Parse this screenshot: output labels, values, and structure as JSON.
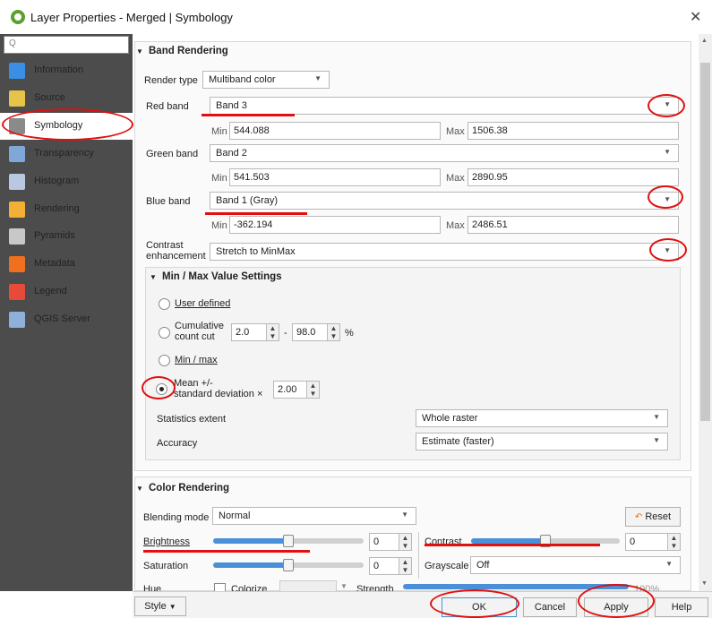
{
  "window": {
    "title": "Layer Properties - Merged | Symbology",
    "close": "✕",
    "search_placeholder": "Q"
  },
  "sidebar": {
    "items": [
      {
        "label": "Information",
        "icon": "information-icon",
        "color": "#3a8ee6"
      },
      {
        "label": "Source",
        "icon": "source-icon",
        "color": "#e8c34a"
      },
      {
        "label": "Symbology",
        "icon": "symbology-icon",
        "color": "#8a8a8a"
      },
      {
        "label": "Transparency",
        "icon": "transparency-icon",
        "color": "#7fa8d8"
      },
      {
        "label": "Histogram",
        "icon": "histogram-icon",
        "color": "#b8c8e0"
      },
      {
        "label": "Rendering",
        "icon": "rendering-icon",
        "color": "#f2b134"
      },
      {
        "label": "Pyramids",
        "icon": "pyramids-icon",
        "color": "#c8c8c8"
      },
      {
        "label": "Metadata",
        "icon": "metadata-icon",
        "color": "#f07020"
      },
      {
        "label": "Legend",
        "icon": "legend-icon",
        "color": "#e84a3a"
      },
      {
        "label": "QGIS Server",
        "icon": "qgis-server-icon",
        "color": "#8fb0d8"
      }
    ],
    "active_index": 2
  },
  "band_rendering": {
    "header": "Band Rendering",
    "render_type_label": "Render type",
    "render_type_value": "Multiband color",
    "red_band_label": "Red band",
    "red_band_value": "Band 3",
    "red_min": "544.088",
    "red_max": "1506.38",
    "green_band_label": "Green band",
    "green_band_value": "Band 2",
    "green_min": "541.503",
    "green_max": "2890.95",
    "blue_band_label": "Blue band",
    "blue_band_value": "Band 1 (Gray)",
    "blue_min": "-362.194",
    "blue_max": "2486.51",
    "min_label": "Min",
    "max_label": "Max",
    "contrast_label_1": "Contrast",
    "contrast_label_2": "enhancement",
    "contrast_value": "Stretch to MinMax"
  },
  "minmax": {
    "header": "Min / Max Value Settings",
    "user_defined": "User defined",
    "cumulative_1": "Cumulative",
    "cumulative_2": "count cut",
    "cum_low": "2.0",
    "cum_high": "98.0",
    "cum_sep": "-",
    "cum_unit": "%",
    "min_max": "Min / max",
    "mean_1": "Mean +/-",
    "mean_2": "standard deviation ×",
    "mean_value": "2.00",
    "selected": "mean",
    "statistics_extent_label": "Statistics extent",
    "statistics_extent_value": "Whole raster",
    "accuracy_label": "Accuracy",
    "accuracy_value": "Estimate (faster)"
  },
  "color_rendering": {
    "header": "Color Rendering",
    "blending_label": "Blending mode",
    "blending_value": "Normal",
    "reset_label": "Reset",
    "brightness_label": "Brightness",
    "brightness_value": "0",
    "contrast_label": "Contrast",
    "contrast_value": "0",
    "saturation_label": "Saturation",
    "saturation_value": "0",
    "grayscale_label": "Grayscale",
    "grayscale_value": "Off",
    "hue_label": "Hue",
    "colorize_label": "Colorize",
    "strength_label": "Strength",
    "strength_value": "100%",
    "brightness_level": 0.5,
    "contrast_level": 0.5,
    "saturation_level": 0.5
  },
  "footer": {
    "style_label": "Style",
    "ok_label": "OK",
    "cancel_label": "Cancel",
    "apply_label": "Apply",
    "help_label": "Help"
  },
  "colors": {
    "annotation_red": "#e01010",
    "sidebar_bg": "#4c4c4c",
    "slider_blue": "#4a90d9"
  }
}
